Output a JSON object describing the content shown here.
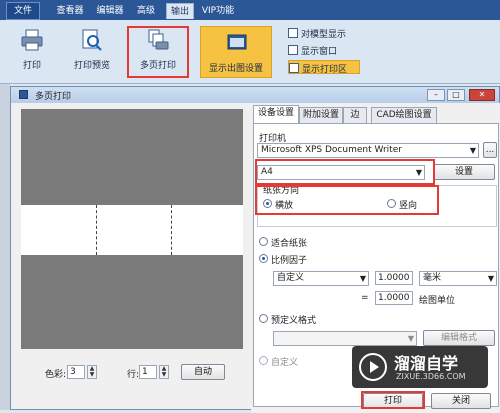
{
  "ribbon": {
    "tabs": [
      "文件",
      "查看器",
      "编辑器",
      "高级",
      "输出",
      "VIP功能"
    ],
    "buttons": {
      "print": "打印",
      "preview": "打印预览",
      "multipage": "多页打印",
      "show_settings": "显示出图设置"
    },
    "checks": {
      "model": "对模型显示",
      "window": "显示窗口",
      "area": "显示打印区"
    }
  },
  "dialog": {
    "title": "多页打印",
    "controls": {
      "min": "–",
      "max": "□",
      "close": "✕"
    },
    "left": {
      "color_label": "色彩:",
      "color_value": "3",
      "row_label": "行:",
      "row_value": "1",
      "auto_button": "自动"
    },
    "tabs": [
      "设备设置",
      "附加设置",
      "边",
      "CAD绘图设置"
    ],
    "printer_label": "打印机",
    "printer_value": "Microsoft XPS Document Writer",
    "more_button": "...",
    "paper_value": "A4",
    "settings_button": "设置",
    "orientation_label": "纸张方向",
    "landscape": "横放",
    "portrait": "竖向",
    "fit_paper": "适合纸张",
    "scale_factor": "比例因子",
    "custom_combo": "自定义",
    "scale_value": "1.0000",
    "unit": "毫米",
    "equals": "=",
    "scale_value2": "1.0000",
    "drawing_units": "绘图单位",
    "predefined": "预定义格式",
    "edit_format": "编辑格式",
    "custom_radio": "自定义",
    "print_button": "打印",
    "close_button": "关闭"
  },
  "watermark": {
    "brand": "溜溜自学",
    "url": "ZIXUE.3D66.COM"
  },
  "colors": {
    "accent": "#2b5797",
    "highlight": "#e53935",
    "selected_ribbon": "#f5c242"
  }
}
